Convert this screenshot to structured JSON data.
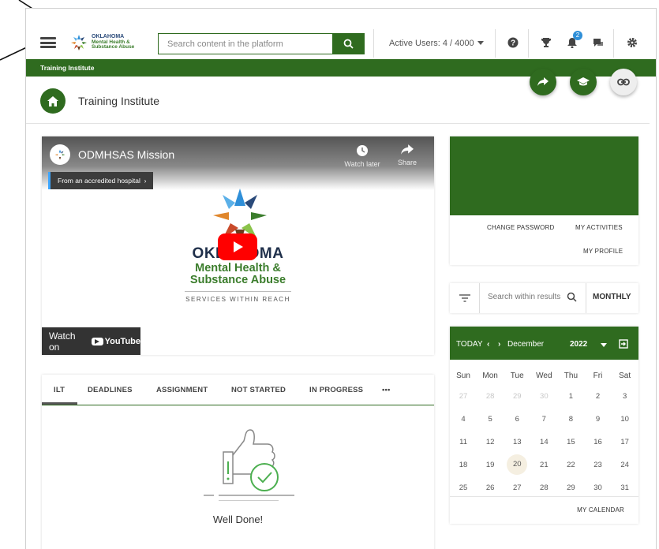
{
  "header": {
    "logo_lines": [
      "OKLAHOMA",
      "Mental Health &",
      "Substance Abuse"
    ],
    "search_placeholder": "Search content in the platform",
    "active_users": "Active Users: 4 / 4000",
    "notification_count": "2"
  },
  "breadcrumb_bar": "Training Institute",
  "page": {
    "title": "Training Institute"
  },
  "video": {
    "title": "ODMHSAS Mission",
    "watch_later": "Watch later",
    "share": "Share",
    "chip": "From an accredited hospital",
    "brand_line1": "OKLAHOMA",
    "brand_line2": "Mental Health &",
    "brand_line3": "Substance Abuse",
    "tagline": "SERVICES WITHIN REACH",
    "watch_on": "Watch on",
    "youtube": "YouTube"
  },
  "tabs": {
    "items": [
      "ILT",
      "DEADLINES",
      "ASSIGNMENT",
      "NOT STARTED",
      "IN PROGRESS",
      "•••"
    ],
    "active": "ILT",
    "empty_message": "Well Done!"
  },
  "profile": {
    "change_password": "CHANGE PASSWORD",
    "my_activities": "MY ACTIVITIES",
    "my_profile": "MY PROFILE"
  },
  "filter": {
    "search_placeholder": "Search within results",
    "view": "MONTHLY"
  },
  "calendar": {
    "today_label": "TODAY",
    "month": "December",
    "year": "2022",
    "weekdays": [
      "Sun",
      "Mon",
      "Tue",
      "Wed",
      "Thu",
      "Fri",
      "Sat"
    ],
    "weeks": [
      [
        "27",
        "28",
        "29",
        "30",
        "1",
        "2",
        "3"
      ],
      [
        "4",
        "5",
        "6",
        "7",
        "8",
        "9",
        "10"
      ],
      [
        "11",
        "12",
        "13",
        "14",
        "15",
        "16",
        "17"
      ],
      [
        "18",
        "19",
        "20",
        "21",
        "22",
        "23",
        "24"
      ],
      [
        "25",
        "26",
        "27",
        "28",
        "29",
        "30",
        "31"
      ]
    ],
    "today": "20",
    "footer_link": "MY CALENDAR"
  },
  "colors": {
    "brand_green": "#2f6b1f",
    "youtube_red": "#ff0000",
    "badge_blue": "#2f8fd8"
  }
}
